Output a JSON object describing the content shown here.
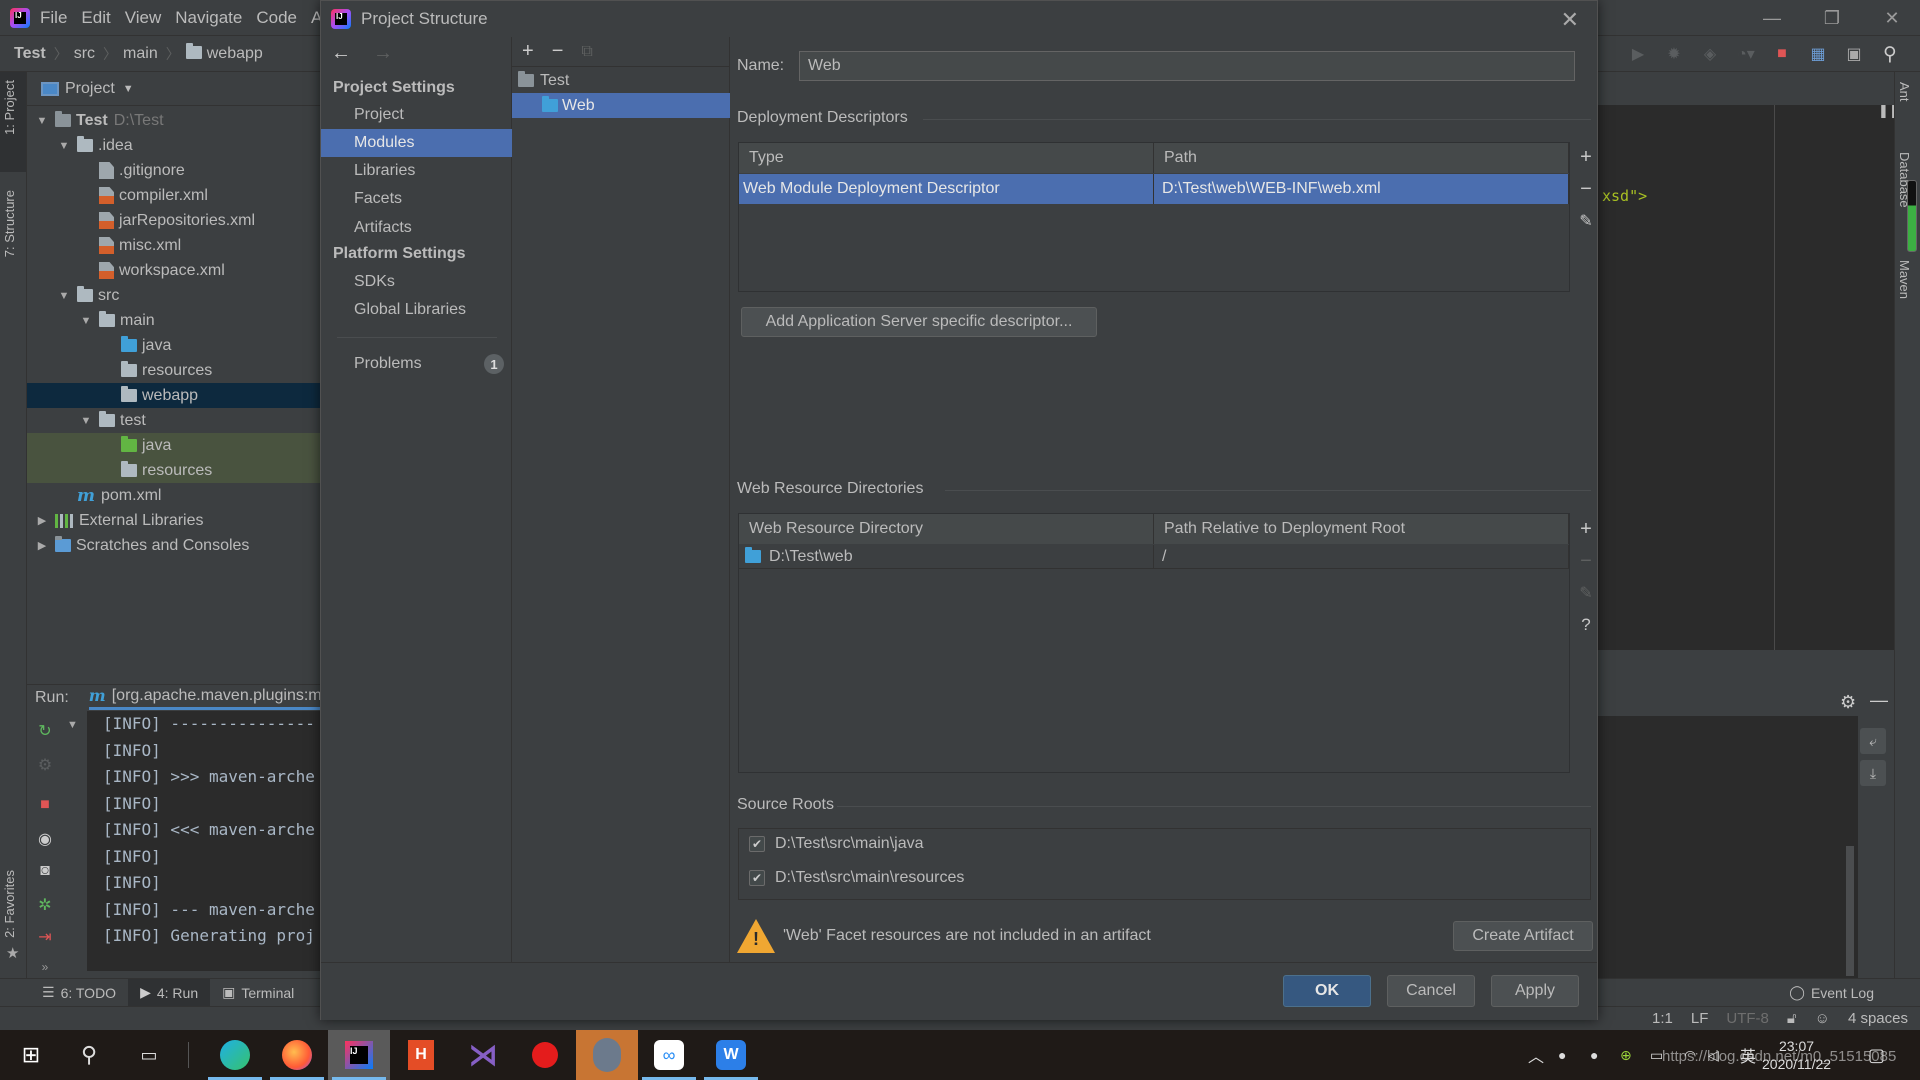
{
  "ide": {
    "menu": [
      "File",
      "Edit",
      "View",
      "Navigate",
      "Code",
      "A"
    ],
    "breadcrumb": [
      "Test",
      "src",
      "main",
      "webapp"
    ],
    "project_panel": {
      "title": "Project",
      "tree": [
        {
          "label": "Test",
          "suffix": "D:\\Test",
          "level": 0,
          "expanded": true,
          "icon": "module-folder-icon"
        },
        {
          "label": ".idea",
          "level": 1,
          "expanded": true,
          "icon": "folder-icon"
        },
        {
          "label": ".gitignore",
          "level": 2,
          "icon": "ignore-file-icon"
        },
        {
          "label": "compiler.xml",
          "level": 2,
          "icon": "xml-file-icon"
        },
        {
          "label": "jarRepositories.xml",
          "level": 2,
          "icon": "xml-file-icon"
        },
        {
          "label": "misc.xml",
          "level": 2,
          "icon": "xml-file-icon"
        },
        {
          "label": "workspace.xml",
          "level": 2,
          "icon": "xml-file-icon"
        },
        {
          "label": "src",
          "level": 1,
          "expanded": true,
          "icon": "folder-icon"
        },
        {
          "label": "main",
          "level": 2,
          "expanded": true,
          "icon": "folder-icon"
        },
        {
          "label": "java",
          "level": 3,
          "icon": "source-folder-icon"
        },
        {
          "label": "resources",
          "level": 3,
          "icon": "resources-folder-icon"
        },
        {
          "label": "webapp",
          "level": 3,
          "icon": "folder-icon",
          "selected": true
        },
        {
          "label": "test",
          "level": 2,
          "expanded": true,
          "icon": "folder-icon"
        },
        {
          "label": "java",
          "level": 3,
          "icon": "test-folder-icon"
        },
        {
          "label": "resources",
          "level": 3,
          "icon": "test-resources-folder-icon"
        },
        {
          "label": "pom.xml",
          "level": 1,
          "icon": "maven-icon"
        },
        {
          "label": "External Libraries",
          "level": 0,
          "expanded": false,
          "icon": "libraries-icon"
        },
        {
          "label": "Scratches and Consoles",
          "level": 0,
          "expanded": false,
          "icon": "scratches-icon"
        }
      ]
    },
    "left_stripe": {
      "project_tab": "1: Project",
      "structure_tab": "7: Structure",
      "favorites_tab": "2: Favorites"
    },
    "right_stripe": {
      "ant": "Ant",
      "database": "Database",
      "maven": "Maven"
    },
    "editor_snippet": "xsd\">",
    "run": {
      "label": "Run:",
      "tab": "[org.apache.maven.plugins:m",
      "console": [
        "[INFO] ---------------",
        "[INFO]",
        "[INFO] >>> maven-arche",
        "[INFO]",
        "[INFO] <<< maven-arche",
        "[INFO]",
        "[INFO]",
        "[INFO] --- maven-arche",
        "[INFO] Generating proj"
      ]
    },
    "bottom_tabs": [
      "6: TODO",
      "4: Run",
      "Terminal"
    ],
    "event_log": "Event Log",
    "status": {
      "position": "1:1",
      "line_sep": "LF",
      "encoding": "UTF-8",
      "indent": "4 spaces"
    }
  },
  "dialog": {
    "title": "Project Structure",
    "nav": {
      "project_settings_header": "Project Settings",
      "project_settings": [
        "Project",
        "Modules",
        "Libraries",
        "Facets",
        "Artifacts"
      ],
      "selected": "Modules",
      "platform_settings_header": "Platform Settings",
      "platform_settings": [
        "SDKs",
        "Global Libraries"
      ],
      "problems_label": "Problems",
      "problems_count": "1"
    },
    "modules": [
      {
        "label": "Test",
        "selected": false
      },
      {
        "label": "Web",
        "selected": true
      }
    ],
    "name_label": "Name:",
    "name_value": "Web",
    "deployment_descriptors": {
      "title": "Deployment Descriptors",
      "columns": [
        "Type",
        "Path"
      ],
      "rows": [
        [
          "Web Module Deployment Descriptor",
          "D:\\Test\\web\\WEB-INF\\web.xml"
        ]
      ],
      "add_server_button": "Add Application Server specific descriptor..."
    },
    "web_resource_directories": {
      "title": "Web Resource Directories",
      "columns": [
        "Web Resource Directory",
        "Path Relative to Deployment Root"
      ],
      "rows": [
        [
          "D:\\Test\\web",
          "/"
        ]
      ]
    },
    "source_roots": {
      "title": "Source Roots",
      "items": [
        {
          "path": "D:\\Test\\src\\main\\java",
          "checked": true
        },
        {
          "path": "D:\\Test\\src\\main\\resources",
          "checked": true
        }
      ]
    },
    "warning": "'Web' Facet resources are not included in an artifact",
    "create_artifact_button": "Create Artifact",
    "buttons": {
      "ok": "OK",
      "cancel": "Cancel",
      "apply": "Apply"
    }
  },
  "taskbar": {
    "time": "23:07",
    "date": "2020/11/22",
    "ime": "英",
    "watermark": "https://blog.csdn.net/m0_51515085"
  }
}
